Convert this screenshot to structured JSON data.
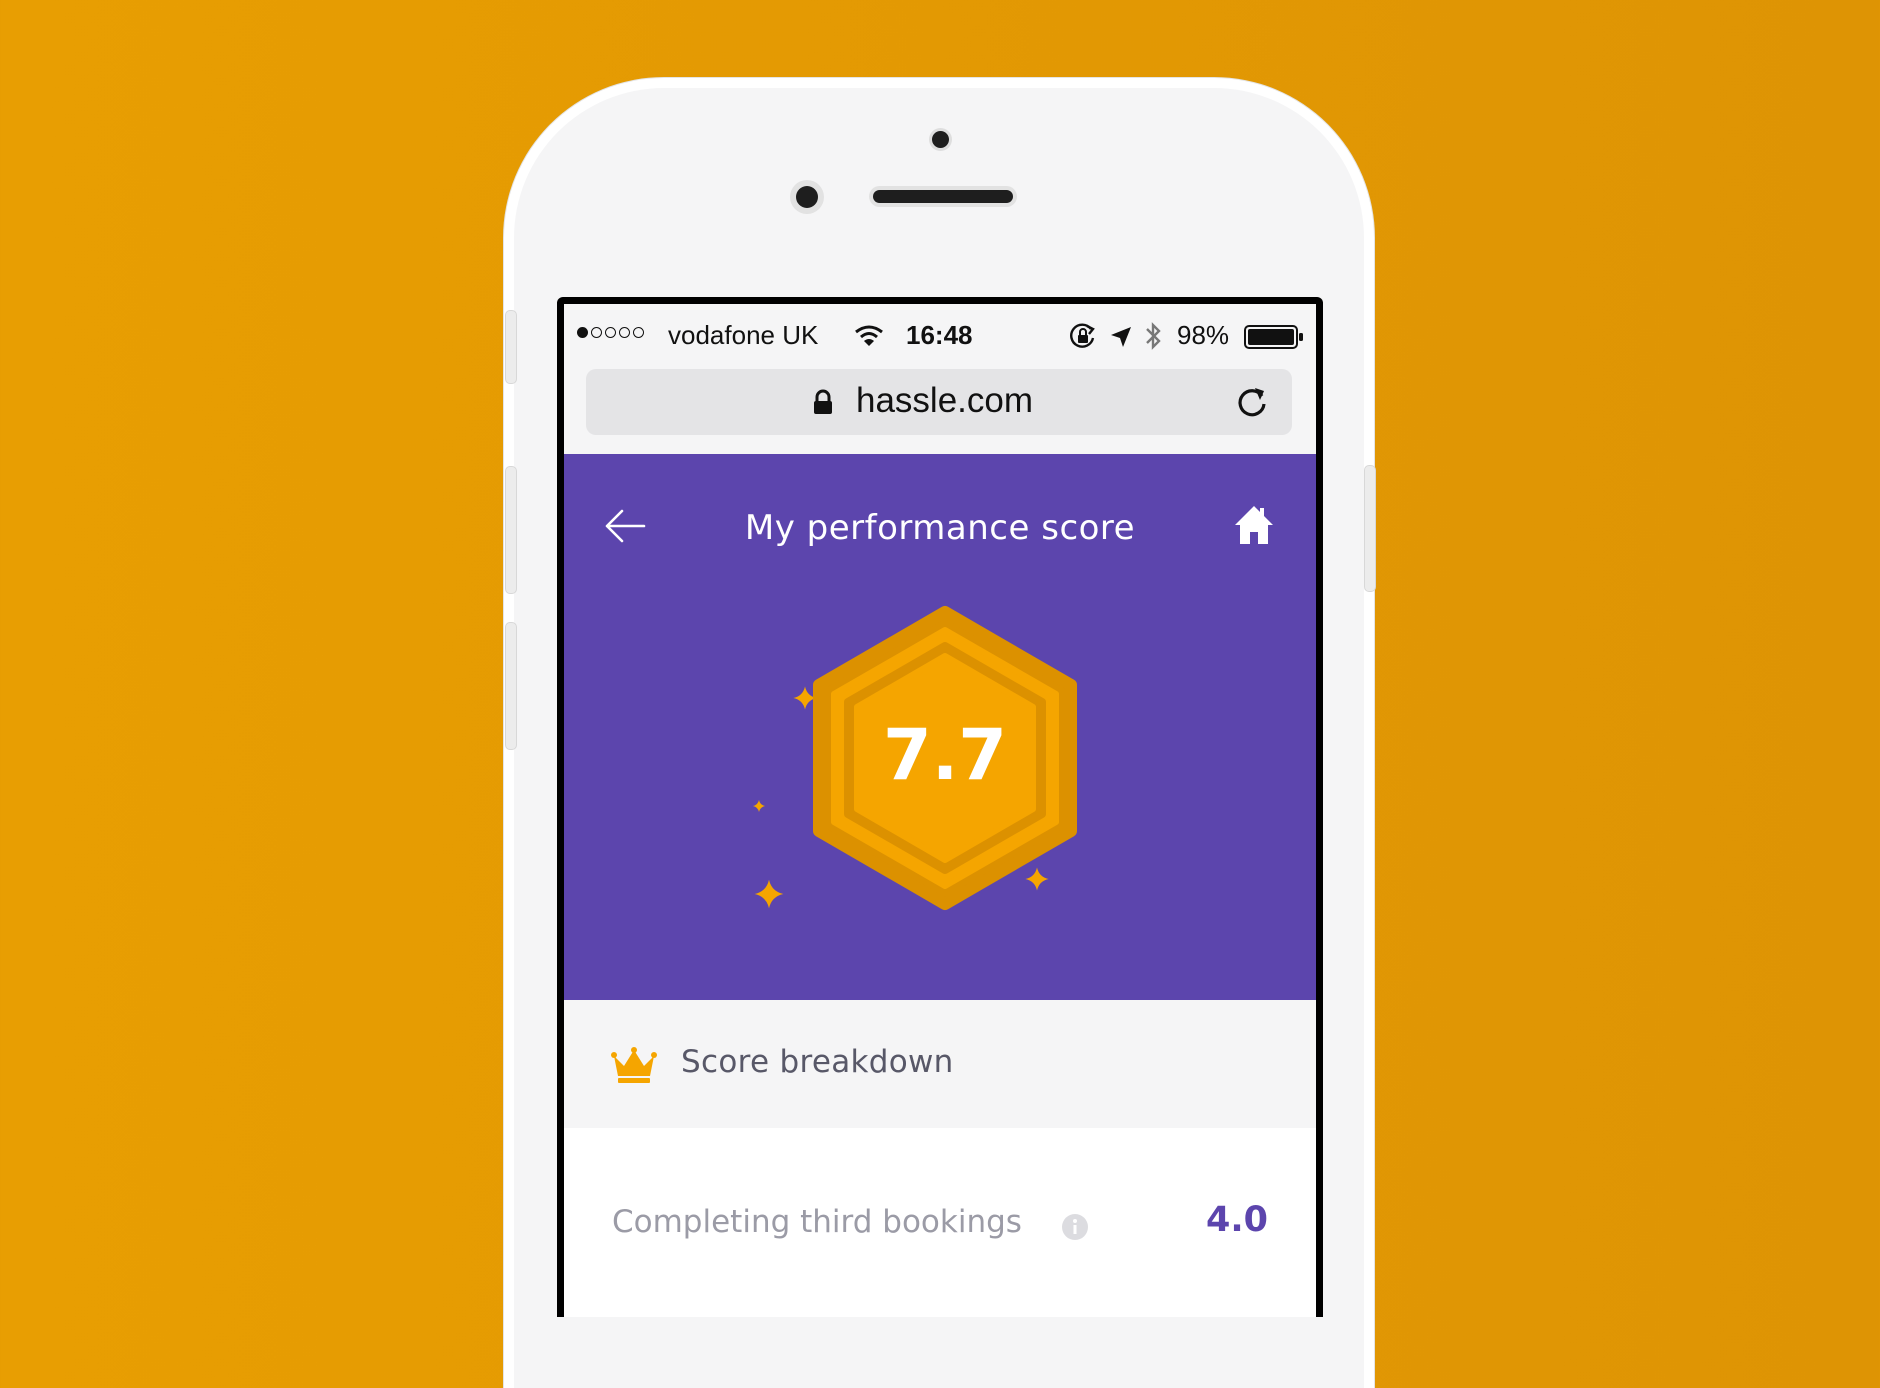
{
  "status_bar": {
    "carrier": "vodafone UK",
    "time": "16:48",
    "battery_percent": "98%",
    "signal_strength_filled": 1,
    "signal_strength_total": 5
  },
  "browser": {
    "url": "hassle.com"
  },
  "header": {
    "title": "My performance score"
  },
  "score": {
    "value": "7.7"
  },
  "breakdown": {
    "title": "Score breakdown",
    "rows": [
      {
        "label": "Completing third bookings",
        "value": "4.0"
      }
    ]
  },
  "icons": [
    "wifi-icon",
    "orientation-lock-icon",
    "location-arrow-icon",
    "bluetooth-icon",
    "battery-icon",
    "padlock-icon",
    "reload-icon",
    "back-arrow-icon",
    "home-icon",
    "hexagon-badge-icon",
    "sparkle-icon",
    "crown-icon",
    "info-icon"
  ],
  "colors": {
    "background": "#e89e02",
    "brand_purple": "#5c45ad",
    "accent_orange": "#f5a500",
    "badge_ring": "#dc9100"
  }
}
